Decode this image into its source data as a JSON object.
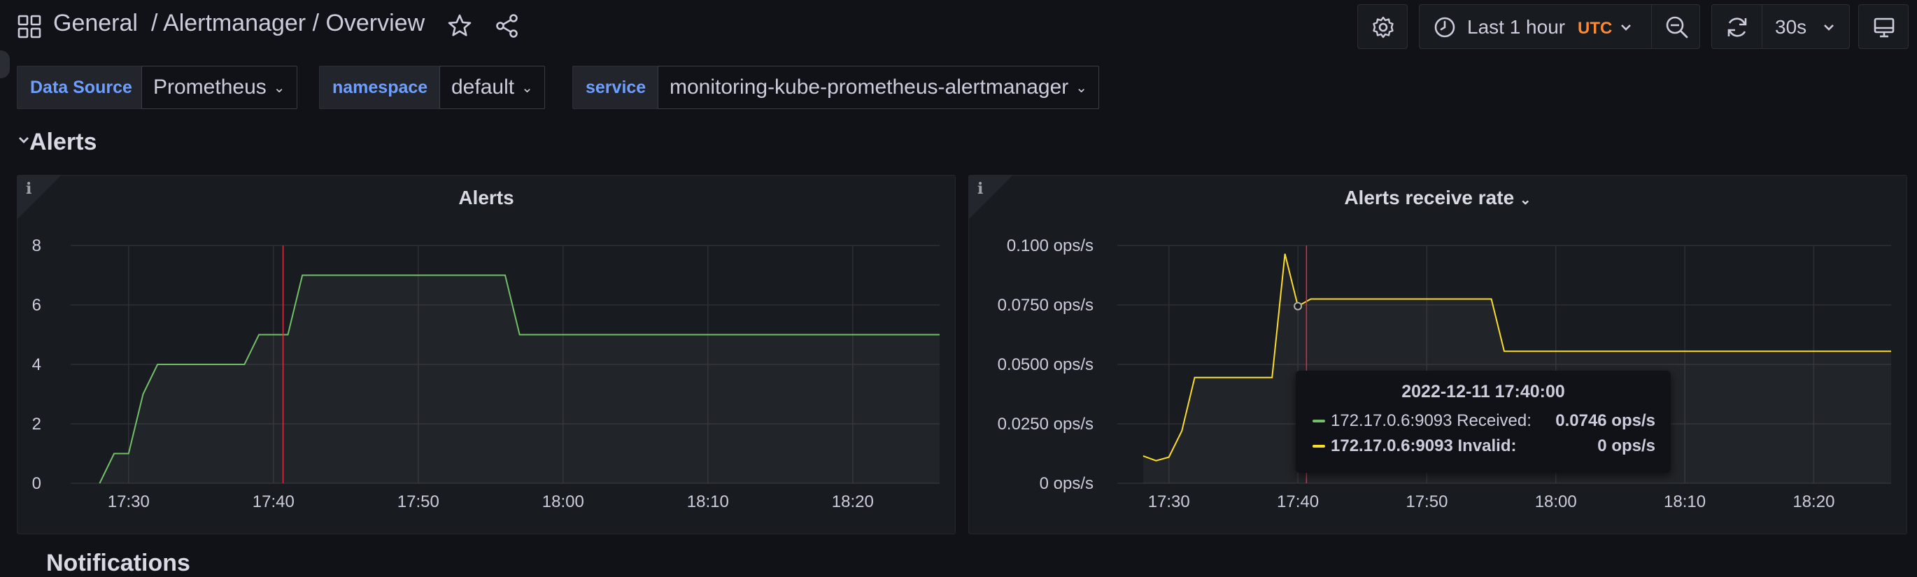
{
  "breadcrumb": {
    "folder": "General",
    "rest": "/ Alertmanager / Overview"
  },
  "toolbar": {
    "time_range": "Last 1 hour",
    "timezone": "UTC",
    "refresh_interval": "30s"
  },
  "variables": [
    {
      "label": "Data Source",
      "value": "Prometheus"
    },
    {
      "label": "namespace",
      "value": "default"
    },
    {
      "label": "service",
      "value": "monitoring-kube-prometheus-alertmanager"
    }
  ],
  "row": {
    "title": "Alerts"
  },
  "next_row": {
    "title": "Notifications"
  },
  "colors": {
    "green_series": "#73bf69",
    "yellow_series": "#fade2a",
    "cursor": "#e02f44",
    "grid": "#2d2f34",
    "label_blue": "#6e9fff",
    "utc_orange": "#ff8833"
  },
  "chart_data": [
    {
      "type": "line",
      "title": "Alerts",
      "x_ticks": [
        "17:30",
        "17:40",
        "17:50",
        "18:00",
        "18:10",
        "18:20"
      ],
      "y_ticks": [
        "0",
        "2",
        "4",
        "6",
        "8"
      ],
      "ylim": [
        0,
        8
      ],
      "xlim": [
        "17:26",
        "18:26"
      ],
      "cursor_x": "17:40:40",
      "series": [
        {
          "name": "",
          "color": "#73bf69",
          "x": [
            "17:28",
            "17:29",
            "17:30",
            "17:31",
            "17:32",
            "17:38",
            "17:39",
            "17:40",
            "17:41",
            "17:42",
            "17:56",
            "17:57",
            "18:26"
          ],
          "values": [
            0,
            1,
            1,
            3,
            4,
            4,
            5,
            5,
            5,
            7,
            7,
            5,
            5
          ]
        }
      ]
    },
    {
      "type": "line",
      "title": "Alerts receive rate",
      "x_ticks": [
        "17:30",
        "17:40",
        "17:50",
        "18:00",
        "18:10",
        "18:20"
      ],
      "y_ticks": [
        "0 ops/s",
        "0.0250 ops/s",
        "0.0500 ops/s",
        "0.0750 ops/s",
        "0.100 ops/s"
      ],
      "ylim": [
        0,
        0.1
      ],
      "xlim": [
        "17:26",
        "18:26"
      ],
      "cursor_x": "17:40:40",
      "series": [
        {
          "name": "",
          "color": "#fade2a",
          "x": [
            "17:28",
            "17:29",
            "17:30",
            "17:31",
            "17:32",
            "17:37",
            "17:38",
            "17:39",
            "17:40",
            "17:41",
            "17:55",
            "17:56",
            "18:26"
          ],
          "values": [
            0.0115,
            0.0095,
            0.011,
            0.022,
            0.0445,
            0.0445,
            0.0445,
            0.0965,
            0.0745,
            0.0775,
            0.0775,
            0.0555,
            0.0555
          ]
        }
      ],
      "tooltip": {
        "time": "2022-12-11 17:40:00",
        "rows": [
          {
            "name": "172.17.0.6:9093 Received:",
            "value": "0.0746 ops/s",
            "color": "#73bf69"
          },
          {
            "name": "172.17.0.6:9093 Invalid:",
            "value": "0 ops/s",
            "color": "#fade2a"
          }
        ]
      }
    }
  ]
}
